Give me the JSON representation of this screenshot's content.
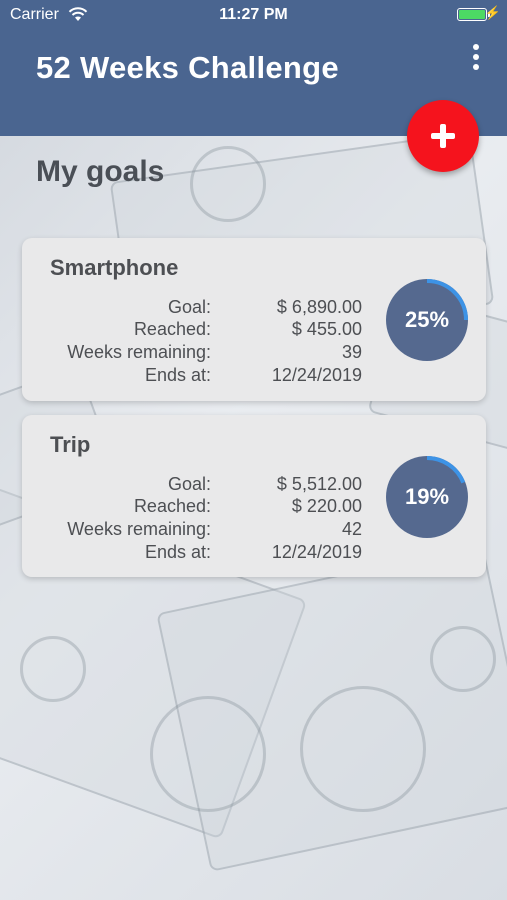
{
  "status_bar": {
    "carrier": "Carrier",
    "time": "11:27 PM"
  },
  "header": {
    "title": "52 Weeks Challenge"
  },
  "section": {
    "title": "My goals"
  },
  "colors": {
    "header_bg": "#4a6590",
    "fab": "#f5131d",
    "progress_bg": "#55698f",
    "progress_arc": "#3d93e6"
  },
  "goals": [
    {
      "name": "Smartphone",
      "goal_label": "Goal:",
      "goal_value": "$ 6,890.00",
      "reached_label": "Reached:",
      "reached_value": "$ 455.00",
      "weeks_label": "Weeks remaining:",
      "weeks_value": "39",
      "ends_label": "Ends at:",
      "ends_value": "12/24/2019",
      "percent_label": "25%",
      "percent": 25
    },
    {
      "name": "Trip",
      "goal_label": "Goal:",
      "goal_value": "$ 5,512.00",
      "reached_label": "Reached:",
      "reached_value": "$ 220.00",
      "weeks_label": "Weeks remaining:",
      "weeks_value": "42",
      "ends_label": "Ends at:",
      "ends_value": "12/24/2019",
      "percent_label": "19%",
      "percent": 19
    }
  ],
  "icons": {
    "wifi": "wifi-icon",
    "battery": "battery-icon",
    "menu": "more-vertical-icon",
    "add": "plus-icon"
  }
}
